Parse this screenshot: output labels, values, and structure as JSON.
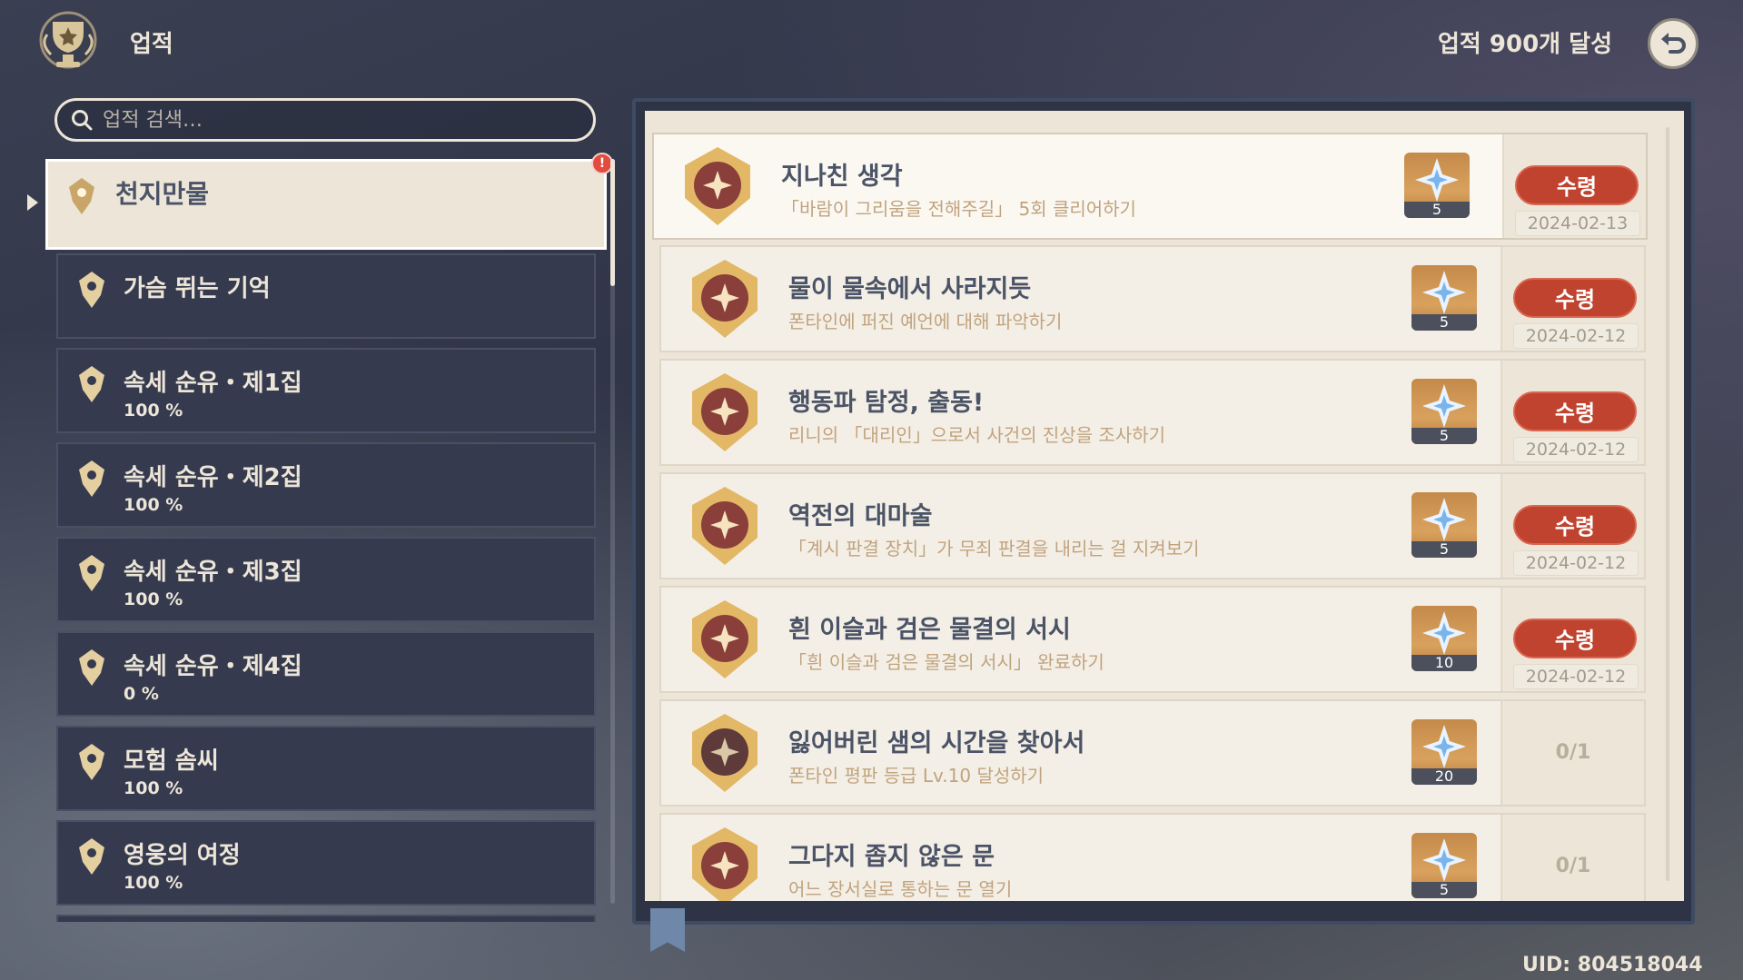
{
  "header": {
    "title": "업적",
    "achievements_count": "업적 900개 달성"
  },
  "search": {
    "placeholder": "업적 검색…"
  },
  "categories": [
    {
      "name": "천지만물",
      "percent": ""
    },
    {
      "name": "가슴 뛰는 기억",
      "percent": ""
    },
    {
      "name": "속세 순유・제1집",
      "percent": "100 %"
    },
    {
      "name": "속세 순유・제2집",
      "percent": "100 %"
    },
    {
      "name": "속세 순유・제3집",
      "percent": "100 %"
    },
    {
      "name": "속세 순유・제4집",
      "percent": "0 %"
    },
    {
      "name": "모험 솜씨",
      "percent": "100 %"
    },
    {
      "name": "영웅의 여정",
      "percent": "100 %"
    }
  ],
  "alert_badge": "!",
  "achievements": [
    {
      "title": "지나친 생각",
      "desc": "「바람이 그리움을 전해주길」 5회 클리어하기",
      "reward": "5",
      "action": "수령",
      "date": "2024-02-13"
    },
    {
      "title": "물이 물속에서 사라지듯",
      "desc": "폰타인에 퍼진 예언에 대해 파악하기",
      "reward": "5",
      "action": "수령",
      "date": "2024-02-12"
    },
    {
      "title": "행동파 탐정, 출동!",
      "desc": "리니의 「대리인」으로서 사건의 진상을 조사하기",
      "reward": "5",
      "action": "수령",
      "date": "2024-02-12"
    },
    {
      "title": "역전의 대마술",
      "desc": "「계시 판결 장치」가 무죄 판결을 내리는 걸 지켜보기",
      "reward": "5",
      "action": "수령",
      "date": "2024-02-12"
    },
    {
      "title": "흰 이슬과 검은 물결의 서시",
      "desc": "「흰 이슬과 검은 물결의 서시」 완료하기",
      "reward": "10",
      "action": "수령",
      "date": "2024-02-12"
    },
    {
      "title": "잃어버린 샘의 시간을 찾아서",
      "desc": "폰타인 평판 등급 Lv.10 달성하기",
      "reward": "20",
      "progress": "0/1"
    },
    {
      "title": "그다지 좁지 않은 문",
      "desc": "어느 장서실로 통하는 문 열기",
      "reward": "5",
      "progress": "0/1"
    }
  ],
  "uid": "UID: 804518044",
  "colors": {
    "accent_red": "#c0432f",
    "cream": "#ece5d8",
    "text_dark": "#4b5366",
    "desc_gold": "#c0a37e"
  }
}
